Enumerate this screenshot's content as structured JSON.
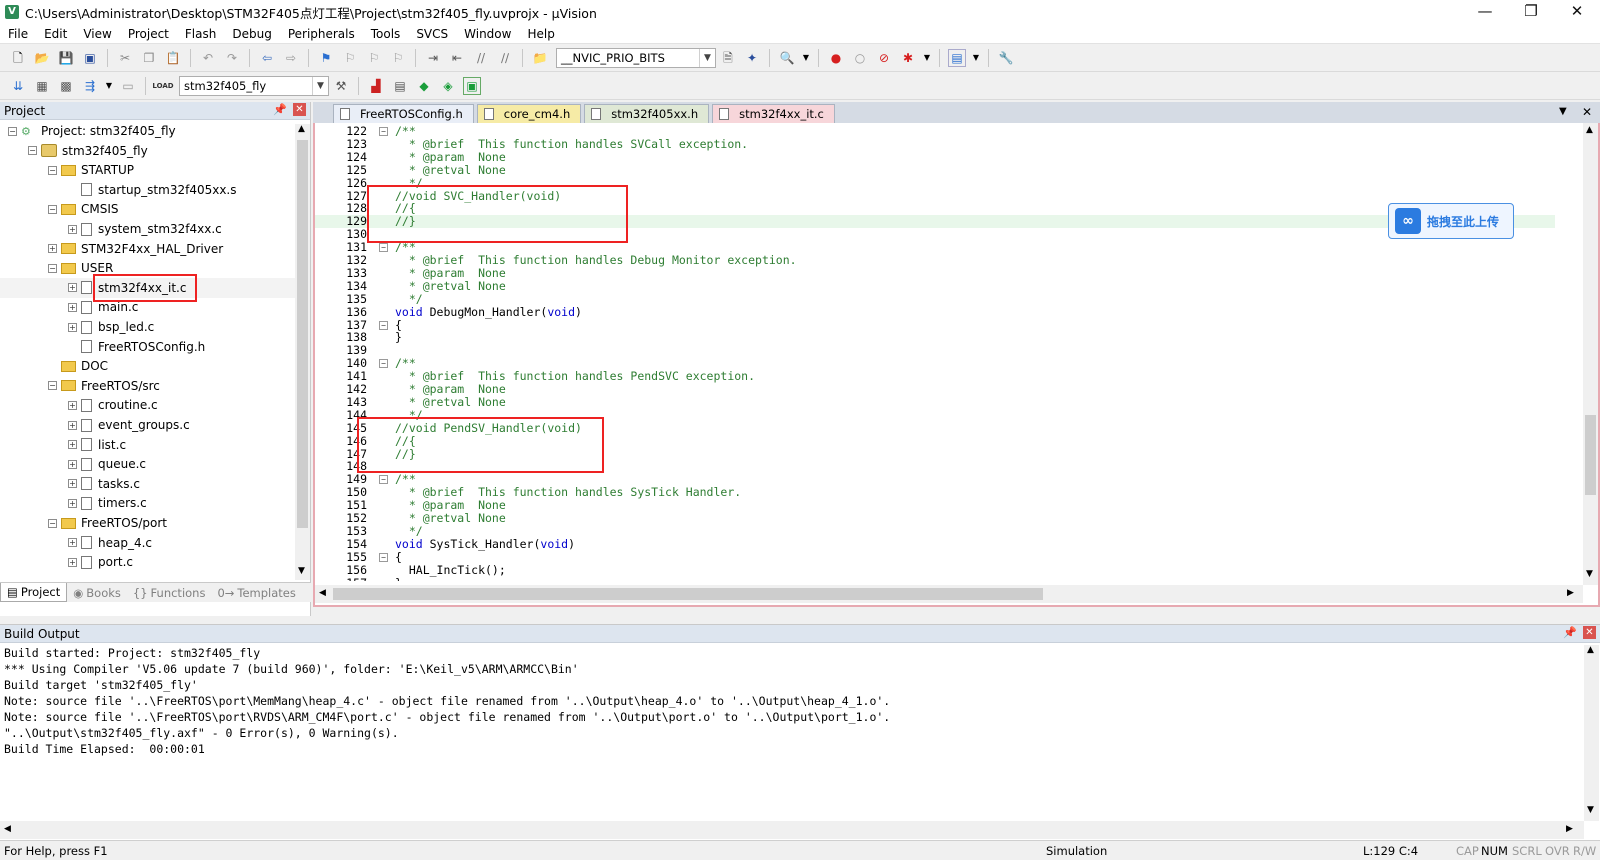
{
  "window": {
    "title": "C:\\Users\\Administrator\\Desktop\\STM32F405点灯工程\\Project\\stm32f405_fly.uvprojx - µVision",
    "app_icon": "V",
    "minimize": "—",
    "maximize": "❐",
    "close": "✕"
  },
  "menu": [
    "File",
    "Edit",
    "View",
    "Project",
    "Flash",
    "Debug",
    "Peripherals",
    "Tools",
    "SVCS",
    "Window",
    "Help"
  ],
  "toolbar": {
    "define_combo": "__NVIC_PRIO_BITS",
    "target_combo": "stm32f405_fly",
    "load_label": "LOAD"
  },
  "project_panel": {
    "title": "Project",
    "pin": "📌",
    "close": "✕",
    "tree": [
      {
        "label": "Project: stm32f405_fly",
        "level": 0,
        "kind": "project",
        "exp": "−"
      },
      {
        "label": "stm32f405_fly",
        "level": 1,
        "kind": "target",
        "exp": "−"
      },
      {
        "label": "STARTUP",
        "level": 2,
        "kind": "folder",
        "exp": "−"
      },
      {
        "label": "startup_stm32f405xx.s",
        "level": 3,
        "kind": "file",
        "exp": ""
      },
      {
        "label": "CMSIS",
        "level": 2,
        "kind": "folder",
        "exp": "−"
      },
      {
        "label": "system_stm32f4xx.c",
        "level": 3,
        "kind": "file",
        "exp": "+"
      },
      {
        "label": "STM32F4xx_HAL_Driver",
        "level": 2,
        "kind": "folder",
        "exp": "+"
      },
      {
        "label": "USER",
        "level": 2,
        "kind": "folder",
        "exp": "−"
      },
      {
        "label": "stm32f4xx_it.c",
        "level": 3,
        "kind": "file",
        "exp": "+"
      },
      {
        "label": "main.c",
        "level": 3,
        "kind": "file",
        "exp": "+"
      },
      {
        "label": "bsp_led.c",
        "level": 3,
        "kind": "file",
        "exp": "+"
      },
      {
        "label": "FreeRTOSConfig.h",
        "level": 3,
        "kind": "file",
        "exp": ""
      },
      {
        "label": "DOC",
        "level": 2,
        "kind": "folder",
        "exp": ""
      },
      {
        "label": "FreeRTOS/src",
        "level": 2,
        "kind": "folder",
        "exp": "−"
      },
      {
        "label": "croutine.c",
        "level": 3,
        "kind": "file",
        "exp": "+"
      },
      {
        "label": "event_groups.c",
        "level": 3,
        "kind": "file",
        "exp": "+"
      },
      {
        "label": "list.c",
        "level": 3,
        "kind": "file",
        "exp": "+"
      },
      {
        "label": "queue.c",
        "level": 3,
        "kind": "file",
        "exp": "+"
      },
      {
        "label": "tasks.c",
        "level": 3,
        "kind": "file",
        "exp": "+"
      },
      {
        "label": "timers.c",
        "level": 3,
        "kind": "file",
        "exp": "+"
      },
      {
        "label": "FreeRTOS/port",
        "level": 2,
        "kind": "folder",
        "exp": "−"
      },
      {
        "label": "heap_4.c",
        "level": 3,
        "kind": "file",
        "exp": "+"
      },
      {
        "label": "port.c",
        "level": 3,
        "kind": "file",
        "exp": "+"
      }
    ],
    "tabs": [
      {
        "label": "Project",
        "icon": "▤",
        "active": true
      },
      {
        "label": "Books",
        "icon": "◉",
        "active": false
      },
      {
        "label": "Functions",
        "icon": "{}",
        "active": false
      },
      {
        "label": "Templates",
        "icon": "0→",
        "active": false
      }
    ]
  },
  "editor": {
    "tabs": [
      {
        "label": "FreeRTOSConfig.h",
        "cls": "t-free"
      },
      {
        "label": "core_cm4.h",
        "cls": "t-core"
      },
      {
        "label": "stm32f405xx.h",
        "cls": "t-stm"
      },
      {
        "label": "stm32f4xx_it.c",
        "cls": "t-it"
      }
    ],
    "tab_menu": "▼",
    "tab_close": "✕",
    "lines": [
      {
        "n": "122",
        "fold": "−",
        "t": "/**",
        "c": "doc"
      },
      {
        "n": "123",
        "fold": "",
        "t": "  * @brief  This function handles SVCall exception.",
        "c": "doc"
      },
      {
        "n": "124",
        "fold": "",
        "t": "  * @param  None",
        "c": "doc"
      },
      {
        "n": "125",
        "fold": "",
        "t": "  * @retval None",
        "c": "doc"
      },
      {
        "n": "126",
        "fold": "",
        "t": "  */",
        "c": "doc"
      },
      {
        "n": "127",
        "fold": "",
        "t": "//void SVC_Handler(void)",
        "c": "cmt"
      },
      {
        "n": "128",
        "fold": "",
        "t": "//{",
        "c": "cmt"
      },
      {
        "n": "129",
        "fold": "",
        "t": "//}",
        "c": "cmt",
        "hl": true
      },
      {
        "n": "130",
        "fold": "",
        "t": "",
        "c": "plain"
      },
      {
        "n": "131",
        "fold": "−",
        "t": "/**",
        "c": "doc"
      },
      {
        "n": "132",
        "fold": "",
        "t": "  * @brief  This function handles Debug Monitor exception.",
        "c": "doc"
      },
      {
        "n": "133",
        "fold": "",
        "t": "  * @param  None",
        "c": "doc"
      },
      {
        "n": "134",
        "fold": "",
        "t": "  * @retval None",
        "c": "doc"
      },
      {
        "n": "135",
        "fold": "",
        "t": "  */",
        "c": "doc"
      },
      {
        "n": "136",
        "fold": "",
        "t": "void DebugMon_Handler(void)",
        "c": "plain"
      },
      {
        "n": "137",
        "fold": "−",
        "t": "{",
        "c": "plain"
      },
      {
        "n": "138",
        "fold": "",
        "t": "}",
        "c": "plain"
      },
      {
        "n": "139",
        "fold": "",
        "t": "",
        "c": "plain"
      },
      {
        "n": "140",
        "fold": "−",
        "t": "/**",
        "c": "doc"
      },
      {
        "n": "141",
        "fold": "",
        "t": "  * @brief  This function handles PendSVC exception.",
        "c": "doc"
      },
      {
        "n": "142",
        "fold": "",
        "t": "  * @param  None",
        "c": "doc"
      },
      {
        "n": "143",
        "fold": "",
        "t": "  * @retval None",
        "c": "doc"
      },
      {
        "n": "144",
        "fold": "",
        "t": "  */",
        "c": "doc"
      },
      {
        "n": "145",
        "fold": "",
        "t": "//void PendSV_Handler(void)",
        "c": "cmt"
      },
      {
        "n": "146",
        "fold": "",
        "t": "//{",
        "c": "cmt"
      },
      {
        "n": "147",
        "fold": "",
        "t": "//}",
        "c": "cmt"
      },
      {
        "n": "148",
        "fold": "",
        "t": "",
        "c": "plain"
      },
      {
        "n": "149",
        "fold": "−",
        "t": "/**",
        "c": "doc"
      },
      {
        "n": "150",
        "fold": "",
        "t": "  * @brief  This function handles SysTick Handler.",
        "c": "doc"
      },
      {
        "n": "151",
        "fold": "",
        "t": "  * @param  None",
        "c": "doc"
      },
      {
        "n": "152",
        "fold": "",
        "t": "  * @retval None",
        "c": "doc"
      },
      {
        "n": "153",
        "fold": "",
        "t": "  */",
        "c": "doc"
      },
      {
        "n": "154",
        "fold": "",
        "t": "void SysTick_Handler(void)",
        "c": "plain"
      },
      {
        "n": "155",
        "fold": "−",
        "t": "{",
        "c": "plain"
      },
      {
        "n": "156",
        "fold": "",
        "t": "  HAL_IncTick();",
        "c": "plain"
      },
      {
        "n": "157",
        "fold": "",
        "t": "}",
        "c": "plain"
      }
    ]
  },
  "upload_overlay": {
    "icon": "∞",
    "label": "拖拽至此上传"
  },
  "build_output": {
    "title": "Build Output",
    "lines": [
      "Build started: Project: stm32f405_fly",
      "*** Using Compiler 'V5.06 update 7 (build 960)', folder: 'E:\\Keil_v5\\ARM\\ARMCC\\Bin'",
      "Build target 'stm32f405_fly'",
      "Note: source file '..\\FreeRTOS\\port\\MemMang\\heap_4.c' - object file renamed from '..\\Output\\heap_4.o' to '..\\Output\\heap_4_1.o'.",
      "Note: source file '..\\FreeRTOS\\port\\RVDS\\ARM_CM4F\\port.c' - object file renamed from '..\\Output\\port.o' to '..\\Output\\port_1.o'.",
      "\"..\\Output\\stm32f405_fly.axf\" - 0 Error(s), 0 Warning(s).",
      "Build Time Elapsed:  00:00:01"
    ]
  },
  "status_bar": {
    "help": "For Help, press F1",
    "mode": "Simulation",
    "position": "L:129 C:4",
    "cap": "CAP",
    "num": "NUM",
    "scrl": "SCRL",
    "ovr": "OVR",
    "rw": "R/W"
  }
}
